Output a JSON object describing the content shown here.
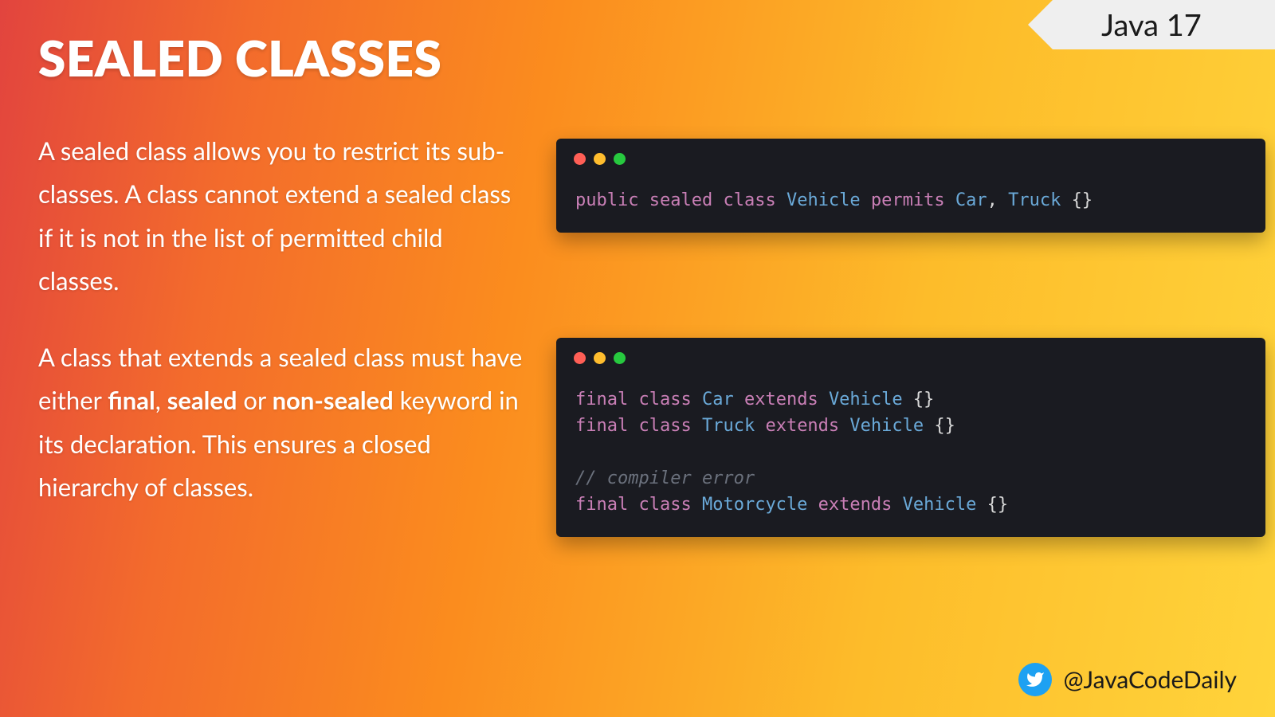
{
  "ribbon": {
    "label": "Java 17"
  },
  "title": "SEALED CLASSES",
  "para1": {
    "t1": "A sealed class allows you to restrict its sub-classes. A class cannot extend a sealed class if it is not in the list of permitted child classes."
  },
  "para2": {
    "t1": "A class that extends a sealed class must have either ",
    "b1": "final",
    "t2": ", ",
    "b2": "sealed",
    "t3": " or ",
    "b3": "non-sealed",
    "t4": " keyword in its declaration. This ensures a closed hierarchy of classes."
  },
  "code1": {
    "kw1": "public",
    "kw2": "sealed",
    "kw3": "class",
    "cl1": "Vehicle",
    "kw4": "permits",
    "cl2": "Car",
    "comma": ",",
    "cl3": "Truck",
    "end": "{}"
  },
  "code2": {
    "l1": {
      "kw1": "final",
      "kw2": "class",
      "cl1": "Car",
      "kw3": "extends",
      "cl2": "Vehicle",
      "end": "{}"
    },
    "l2": {
      "kw1": "final",
      "kw2": "class",
      "cl1": "Truck",
      "kw3": "extends",
      "cl2": "Vehicle",
      "end": "{}"
    },
    "cm": "// compiler error",
    "l3": {
      "kw1": "final",
      "kw2": "class",
      "cl1": "Motorcycle",
      "kw3": "extends",
      "cl2": "Vehicle",
      "end": "{}"
    }
  },
  "footer": {
    "handle": "@JavaCodeDaily"
  }
}
